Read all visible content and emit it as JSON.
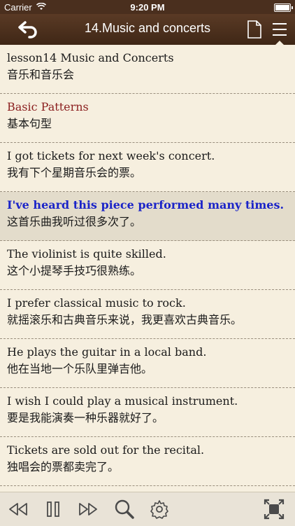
{
  "status": {
    "carrier": "Carrier",
    "time": "9:20 PM"
  },
  "nav": {
    "title": "14.Music and concerts"
  },
  "rows": [
    {
      "en": "lesson14 Music and Concerts",
      "zh": "音乐和音乐会"
    },
    {
      "en": "Basic Patterns",
      "zh": "基本句型"
    },
    {
      "en": "I got tickets for next week's concert.",
      "zh": "我有下个星期音乐会的票。"
    },
    {
      "en": "I've heard this piece performed many times.",
      "zh": "这首乐曲我听过很多次了。"
    },
    {
      "en": "The violinist is quite skilled.",
      "zh": "这个小提琴手技巧很熟练。"
    },
    {
      "en": "I prefer classical music to rock.",
      "zh": "就摇滚乐和古典音乐来说，我更喜欢古典音乐。"
    },
    {
      "en": "He plays the guitar in a local band.",
      "zh": "他在当地一个乐队里弹吉他。"
    },
    {
      "en": "I wish I could play a musical instrument.",
      "zh": "要是我能演奏一种乐器就好了。"
    },
    {
      "en": "Tickets are sold out for the recital.",
      "zh": "独唱会的票都卖完了。"
    }
  ],
  "colors": {
    "nav_bg": "#4a2f1e",
    "page_bg": "#f6efdf",
    "highlight_bg": "#e3dccb",
    "highlight_text": "#1b24c8",
    "section_text": "#8b1f1f"
  },
  "icons": [
    "back-arrow-icon",
    "document-icon",
    "menu-icon",
    "rewind-icon",
    "pause-icon",
    "fast-forward-icon",
    "search-icon",
    "settings-gear-icon",
    "fullscreen-icon"
  ]
}
